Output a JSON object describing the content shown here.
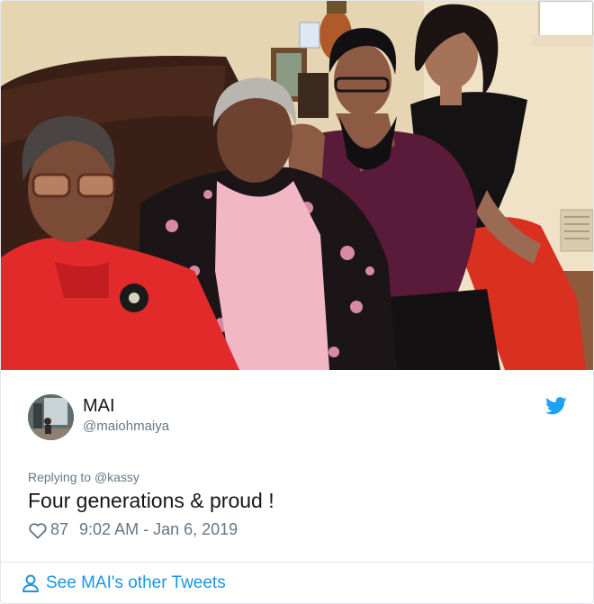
{
  "tweet": {
    "author_name": "MAI",
    "author_handle": "@maiohmaiya",
    "replying_prefix": "Replying to",
    "replying_to": "@kassy",
    "text": "Four generations & proud !",
    "likes": "87",
    "timestamp": "9:02 AM - Jan 6, 2019"
  },
  "footer": {
    "see_more_label": "See MAI's other Tweets"
  },
  "icons": {
    "brand": "twitter-bird-icon",
    "like": "heart-icon",
    "profile": "person-icon"
  },
  "colors": {
    "accent": "#1b95e0",
    "muted_text": "#657786",
    "border": "#e1e8ed"
  }
}
